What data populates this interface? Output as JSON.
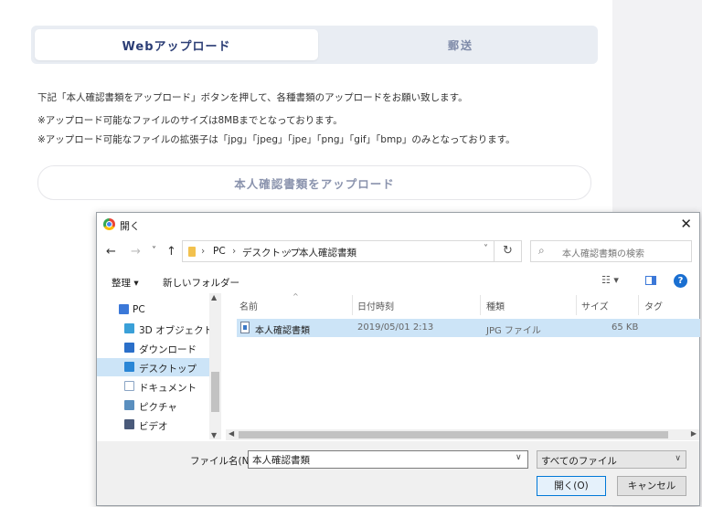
{
  "page": {
    "tabs": [
      {
        "label": "Webアップロード",
        "active": true
      },
      {
        "label": "郵送",
        "active": false
      }
    ],
    "instructions": "下記「本人確認書類をアップロード」ボタンを押して、各種書類のアップロードをお願い致します。",
    "notes": [
      "※アップロード可能なファイルのサイズは8MBまでとなっております。",
      "※アップロード可能なファイルの拡張子は「jpg」「jpeg」「jpe」「png」「gif」「bmp」のみとなっております。"
    ],
    "upload_button": "本人確認書類をアップロード"
  },
  "dialog": {
    "title": "開く",
    "close_glyph": "✕",
    "nav": {
      "back": "←",
      "forward": "→",
      "recent": "˅",
      "up": "↑"
    },
    "breadcrumb": [
      "PC",
      "デスクトップ",
      "本人確認書類"
    ],
    "breadcrumb_sep": "›",
    "search_placeholder": "本人確認書類の検索",
    "toolbar": {
      "organize": "整理 ▾",
      "new_folder": "新しいフォルダー",
      "help": "?"
    },
    "sidebar": [
      {
        "label": "PC",
        "icon": "pc-icon",
        "color": "#3b78d8",
        "selected": false
      },
      {
        "label": "3D オブジェクト",
        "icon": "3d-objects-icon",
        "color": "#3aa0d8",
        "selected": false
      },
      {
        "label": "ダウンロード",
        "icon": "download-icon",
        "color": "#2a6fc9",
        "selected": false
      },
      {
        "label": "デスクトップ",
        "icon": "desktop-icon",
        "color": "#2a86d6",
        "selected": true
      },
      {
        "label": "ドキュメント",
        "icon": "document-icon",
        "color": "#8aa4c4",
        "selected": false
      },
      {
        "label": "ピクチャ",
        "icon": "picture-icon",
        "color": "#5a8fbf",
        "selected": false
      },
      {
        "label": "ビデオ",
        "icon": "video-icon",
        "color": "#4a5a7a",
        "selected": false
      }
    ],
    "columns": [
      "名前",
      "日付時刻",
      "種類",
      "サイズ",
      "タグ"
    ],
    "files": [
      {
        "name": "本人確認書類",
        "date": "2019/05/01 2:13",
        "type": "JPG ファイル",
        "size": "65 KB",
        "tag": ""
      }
    ],
    "filename_label": "ファイル名(N):",
    "filename_value": "本人確認書類",
    "filetype": "すべてのファイル",
    "open_button": "開く(O)",
    "cancel_button": "キャンセル"
  }
}
